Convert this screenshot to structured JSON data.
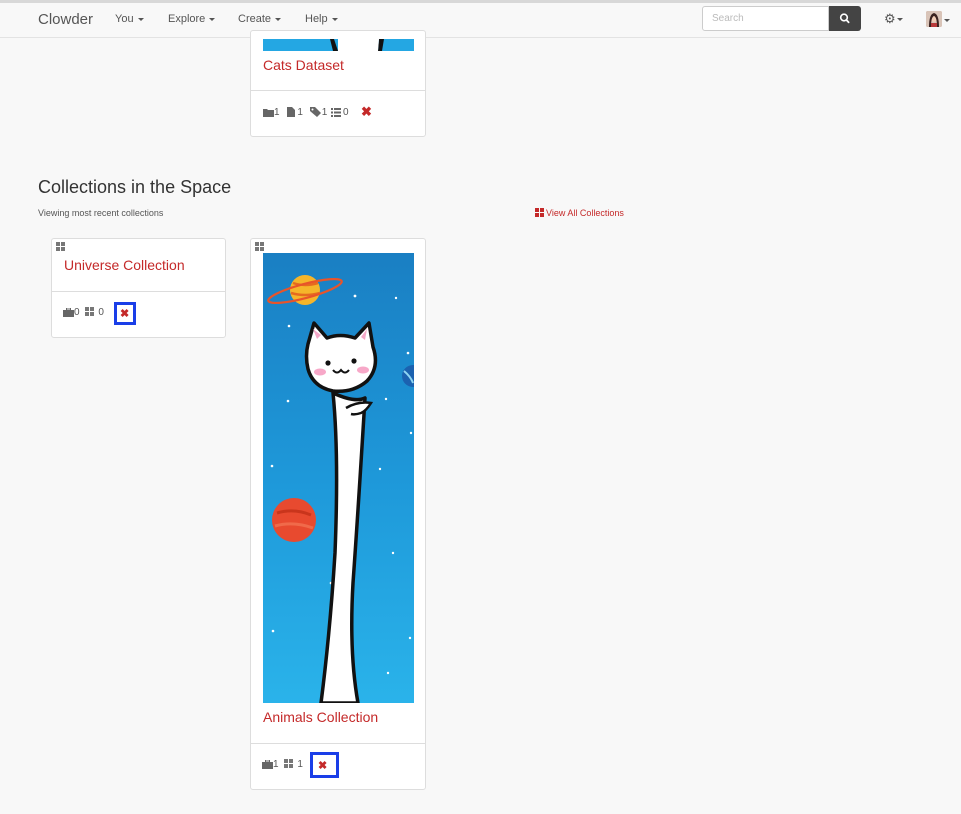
{
  "navbar": {
    "brand": "Clowder",
    "menus": [
      "You",
      "Explore",
      "Create",
      "Help"
    ],
    "search_placeholder": "Search"
  },
  "dataset_card": {
    "title": "Cats Dataset",
    "stats": {
      "folders": "1",
      "files": "1",
      "tags": "1",
      "comments": "0"
    }
  },
  "section": {
    "title": "Collections in the Space",
    "subtitle": "Viewing most recent collections",
    "view_all": "View All Collections"
  },
  "collections": [
    {
      "title": "Universe Collection",
      "datasets": "0",
      "child_collections": "0"
    },
    {
      "title": "Animals Collection",
      "datasets": "1",
      "child_collections": "1"
    }
  ],
  "colors": {
    "link_red": "#c42929",
    "highlight_blue": "#1a3ee8",
    "sky_blue": "#1e8fd1"
  }
}
